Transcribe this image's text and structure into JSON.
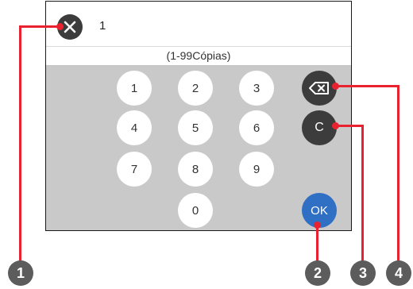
{
  "header": {
    "quantity_value": "1",
    "close_icon": "close-icon"
  },
  "range_text": "(1-99Cópias)",
  "keypad": {
    "keys": [
      "1",
      "2",
      "3",
      "4",
      "5",
      "6",
      "7",
      "8",
      "9",
      "0"
    ],
    "backspace_icon": "backspace-icon",
    "clear_label": "C",
    "ok_label": "OK"
  },
  "callouts": [
    "1",
    "2",
    "3",
    "4"
  ],
  "colors": {
    "callout_red": "#e8232f",
    "ok_blue": "#2f6fc4",
    "dark_button": "#3c3c3c",
    "keypad_bg": "#c9c9c9",
    "badge_gray": "#5c5c5c"
  }
}
